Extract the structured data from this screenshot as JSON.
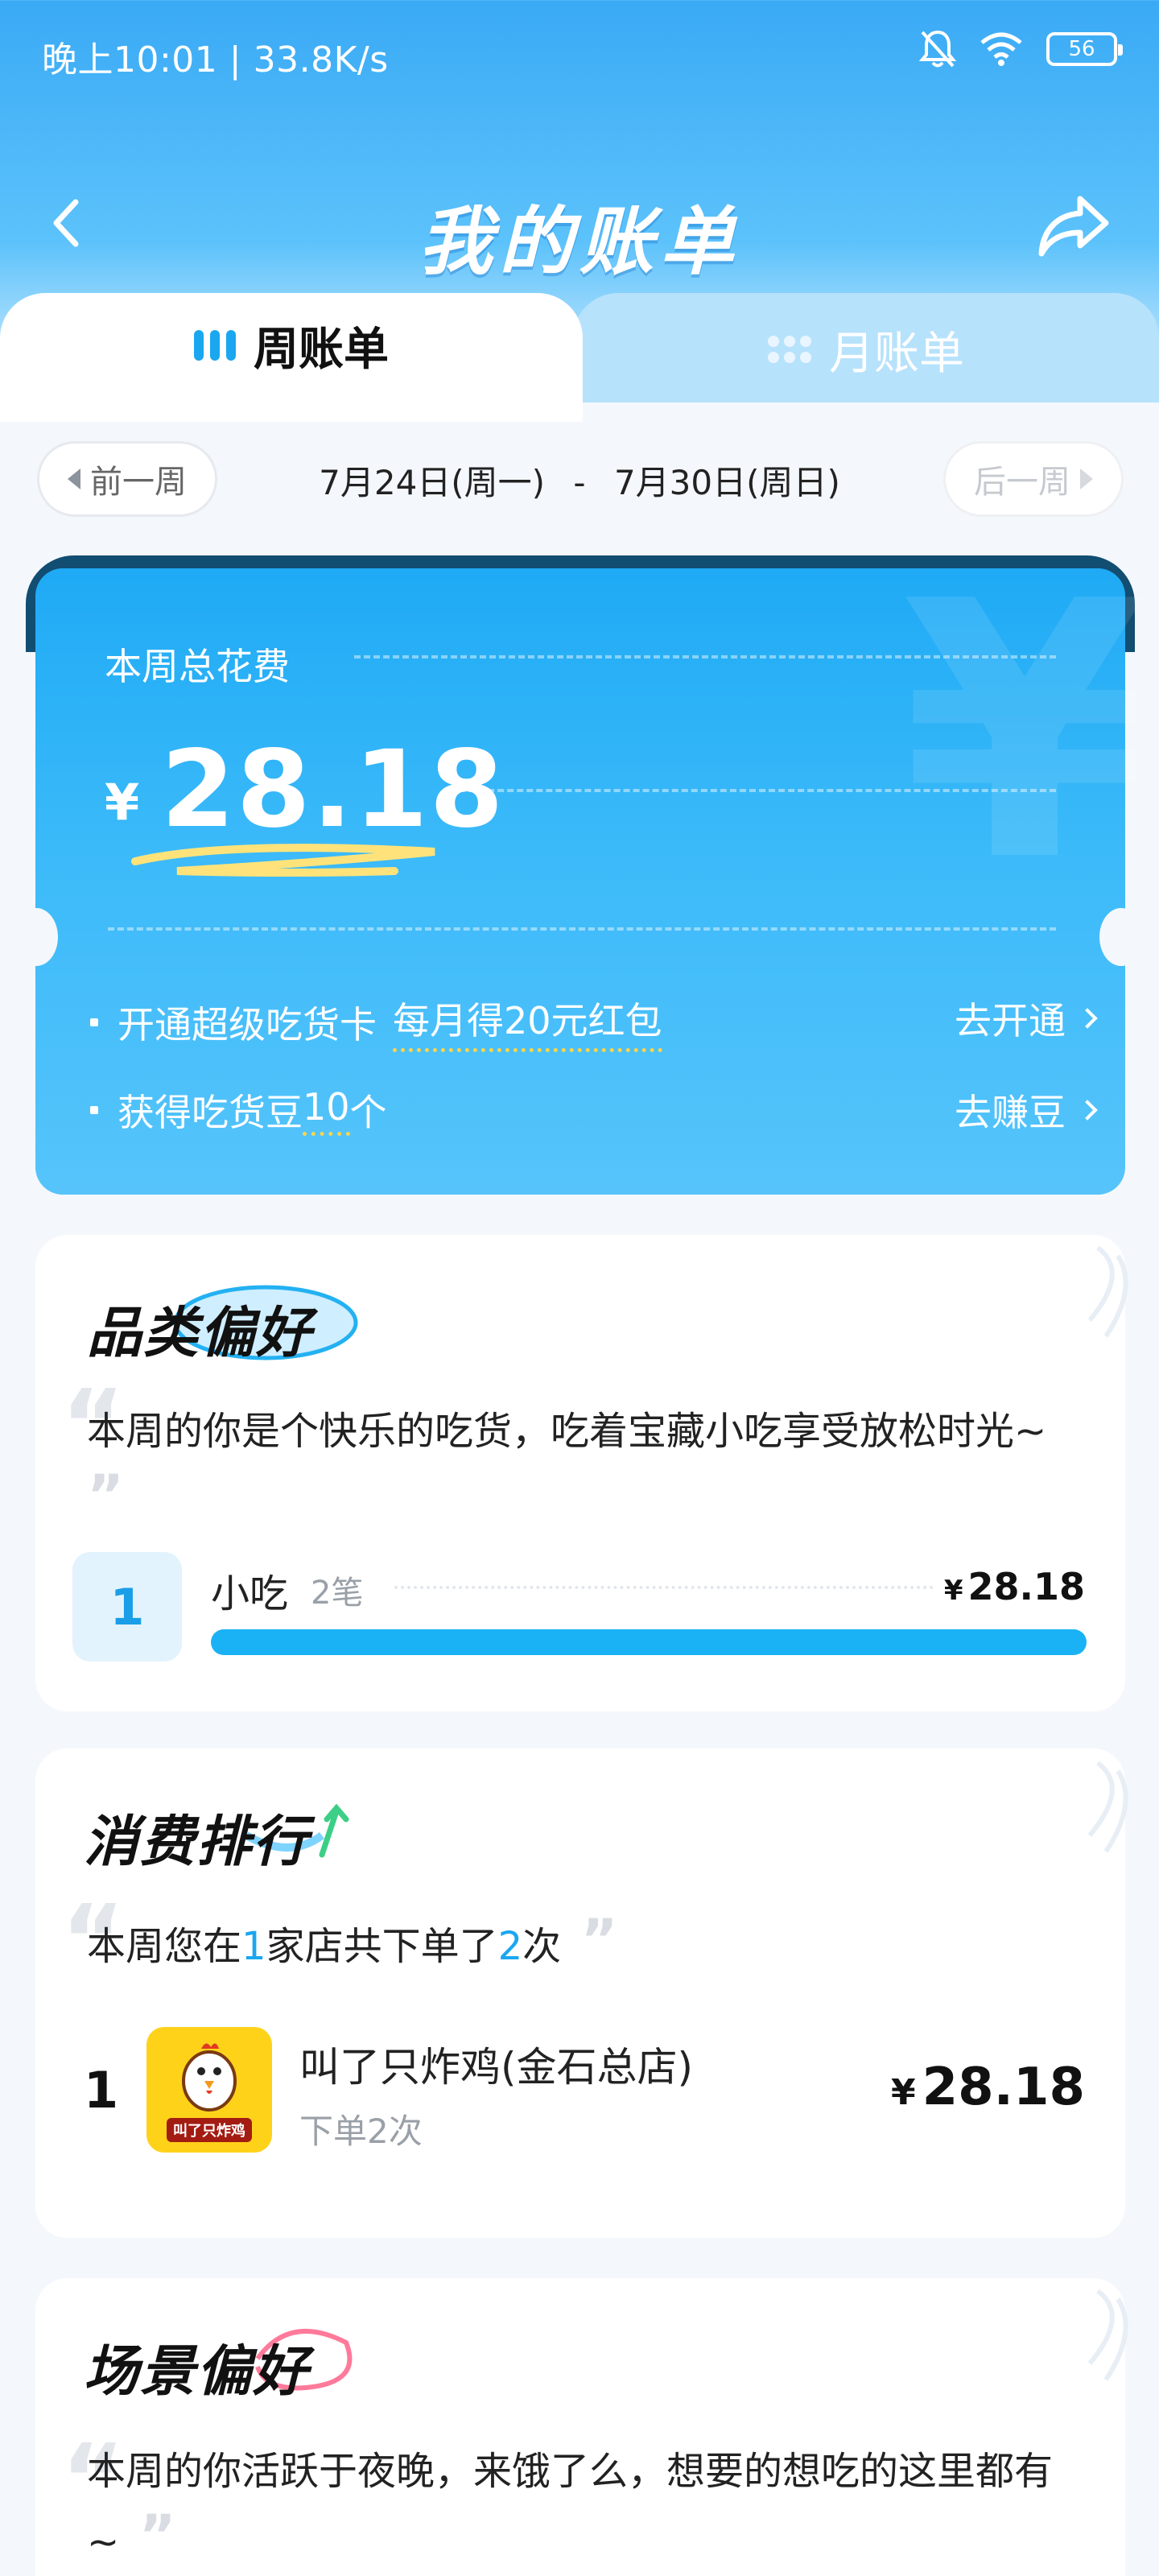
{
  "status_bar": {
    "time_speed": "晚上10:01 | 33.8K/s",
    "battery": "56",
    "icons": [
      "bell-muted-icon",
      "wifi-icon",
      "battery-icon"
    ]
  },
  "header": {
    "title": "我的账单",
    "back_icon": "chevron-left-icon",
    "share_icon": "share-icon"
  },
  "tabs": [
    {
      "label": "周账单",
      "active": true,
      "icon": "bars-icon"
    },
    {
      "label": "月账单",
      "active": false,
      "icon": "dots-icon"
    }
  ],
  "week_nav": {
    "prev": "前一周",
    "next": "后一周",
    "range_start": "7月24日(周一)",
    "range_sep": "-",
    "range_end": "7月30日(周日)"
  },
  "summary": {
    "label": "本周总花费",
    "currency": "¥",
    "amount": "28.18",
    "promos": [
      {
        "text": "开通超级吃货卡",
        "highlight": "每月得20元红包",
        "action": "去开通"
      },
      {
        "text": "获得吃货豆",
        "highlight": "10",
        "suffix": "个",
        "action": "去赚豆"
      }
    ]
  },
  "category": {
    "title": "品类偏好",
    "quote": "本周的你是个快乐的吃货，吃着宝藏小吃享受放松时光~",
    "items": [
      {
        "rank": "1",
        "name": "小吃",
        "count": "2笔",
        "currency": "¥",
        "amount": "28.18",
        "share": 1.0
      }
    ]
  },
  "ranking": {
    "title": "消费排行",
    "quote_pre": "本周您在",
    "quote_num1": "1",
    "quote_mid": "家店共下单了",
    "quote_num2": "2",
    "quote_post": "次",
    "items": [
      {
        "rank": "1",
        "shop": "叫了只炸鸡(金石总店)",
        "orders": "下单2次",
        "currency": "¥",
        "amount": "28.18",
        "logo_text": "叫了只炸鸡"
      }
    ]
  },
  "scene": {
    "title": "场景偏好",
    "quote": "本周的你活跃于夜晚，来饿了么，想要的想吃的这里都有~"
  },
  "colors": {
    "accent": "#1aa7ef",
    "card_blue": "#2db4f7",
    "highlight_yellow": "#ffd54a"
  }
}
